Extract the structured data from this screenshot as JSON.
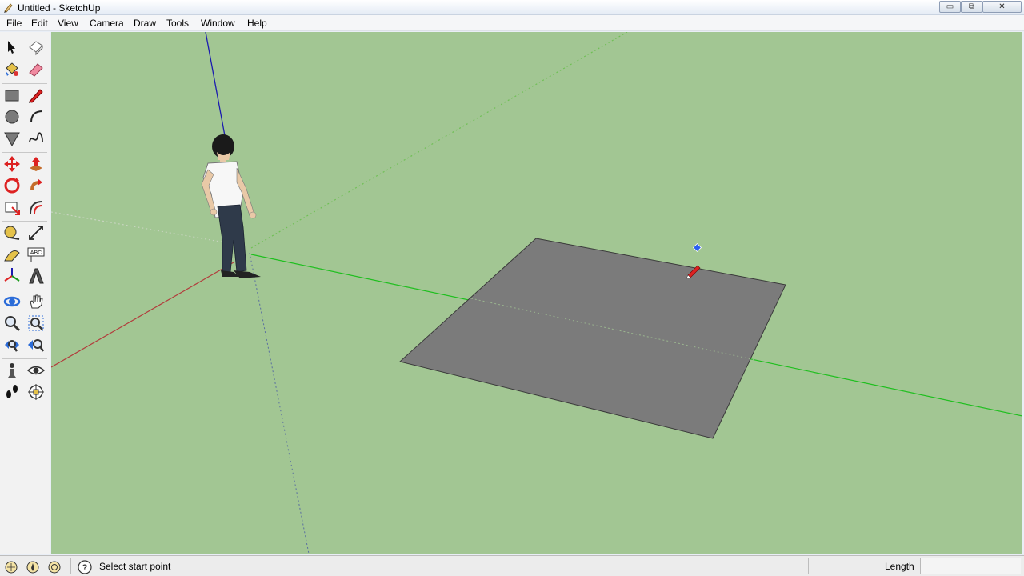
{
  "window": {
    "title": "Untitled - SketchUp",
    "controls": {
      "minimize": "▭",
      "maximize": "⧉",
      "close": "✕"
    }
  },
  "menu": {
    "items": [
      "File",
      "Edit",
      "View",
      "Camera",
      "Draw",
      "Tools",
      "Window",
      "Help"
    ]
  },
  "toolbar": {
    "tools": [
      "select-tool",
      "make-component-tool",
      "paint-bucket-tool",
      "eraser-tool",
      "rectangle-tool",
      "line-tool",
      "circle-tool",
      "arc-tool",
      "polygon-tool",
      "freehand-tool",
      "move-tool",
      "push-pull-tool",
      "rotate-tool",
      "follow-me-tool",
      "scale-tool",
      "offset-tool",
      "tape-measure-tool",
      "dimension-tool",
      "protractor-tool",
      "text-tool",
      "axes-tool",
      "3d-text-tool",
      "orbit-tool",
      "pan-tool",
      "zoom-tool",
      "zoom-window-tool",
      "zoom-extents-tool",
      "previous-view-tool",
      "position-camera-tool",
      "look-around-tool",
      "walk-tool",
      "section-plane-tool"
    ]
  },
  "viewport": {
    "background_color": "#a2c693",
    "face_color": "#7b7b7b",
    "axis_colors": {
      "red": "#b23c3c",
      "green": "#1fbf1f",
      "blue": "#1b1bb0"
    }
  },
  "status": {
    "text": "Select start point",
    "vcb_label": "Length",
    "vcb_value": ""
  }
}
